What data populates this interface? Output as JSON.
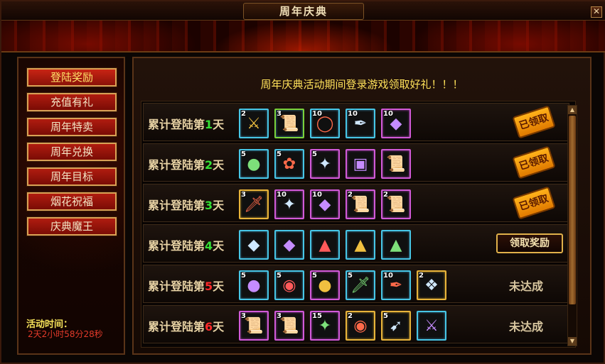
{
  "window": {
    "title": "周年庆典",
    "close_glyph": "✕"
  },
  "sidebar": {
    "items": [
      {
        "label": "登陆奖励",
        "active": true
      },
      {
        "label": "充值有礼"
      },
      {
        "label": "周年特卖"
      },
      {
        "label": "周年兑换"
      },
      {
        "label": "周年目标"
      },
      {
        "label": "烟花祝福"
      },
      {
        "label": "庆典魔王"
      }
    ],
    "activity_time_label": "活动时间：",
    "activity_time_value": "2天2小时58分28秒"
  },
  "main": {
    "headline": "周年庆典活动期间登录游戏领取好礼！！！",
    "rows": [
      {
        "prefix": "累计登陆第",
        "day": "1",
        "suffix": "天",
        "day_color": "#35e035",
        "status_type": "claimed",
        "status": "已领取",
        "items": [
          {
            "count": "2",
            "icon": "sword-icon",
            "glyph": "⚔",
            "q": ""
          },
          {
            "count": "3",
            "icon": "exp-scroll-icon",
            "glyph": "📜",
            "q": "q-green"
          },
          {
            "count": "10",
            "icon": "ring-icon",
            "glyph": "◯",
            "q": ""
          },
          {
            "count": "10",
            "icon": "feather-icon",
            "glyph": "✒",
            "q": ""
          },
          {
            "count": "10",
            "icon": "crystal-icon",
            "glyph": "◆",
            "q": "q-purple"
          }
        ]
      },
      {
        "prefix": "累计登陆第",
        "day": "2",
        "suffix": "天",
        "day_color": "#35e035",
        "status_type": "claimed",
        "status": "已领取",
        "items": [
          {
            "count": "5",
            "icon": "red-orb-icon",
            "glyph": "●",
            "q": ""
          },
          {
            "count": "5",
            "icon": "rose-icon",
            "glyph": "✿",
            "q": ""
          },
          {
            "count": "5",
            "icon": "purple-crystal-icon",
            "glyph": "✦",
            "q": "q-purple"
          },
          {
            "count": "",
            "icon": "spellbook-icon",
            "glyph": "▣",
            "q": "q-purple"
          },
          {
            "count": "",
            "icon": "scroll-icon",
            "glyph": "📜",
            "q": "q-purple"
          }
        ]
      },
      {
        "prefix": "累计登陆第",
        "day": "3",
        "suffix": "天",
        "day_color": "#35e035",
        "status_type": "claimed",
        "status": "已领取",
        "items": [
          {
            "count": "3",
            "icon": "dagger-icon",
            "glyph": "🗡",
            "q": "q-gold"
          },
          {
            "count": "10",
            "icon": "purple-crystal-icon",
            "glyph": "✦",
            "q": "q-purple"
          },
          {
            "count": "10",
            "icon": "crystal-icon",
            "glyph": "◆",
            "q": "q-purple"
          },
          {
            "count": "2",
            "icon": "scroll-icon",
            "glyph": "📜",
            "q": "q-purple"
          },
          {
            "count": "2",
            "icon": "scroll-icon",
            "glyph": "📜",
            "q": "q-purple"
          }
        ]
      },
      {
        "prefix": "累计登陆第",
        "day": "4",
        "suffix": "天",
        "day_color": "#35e035",
        "status_type": "claim",
        "status": "领取奖励",
        "items": [
          {
            "count": "",
            "icon": "red-gem-icon",
            "glyph": "◆",
            "q": ""
          },
          {
            "count": "",
            "icon": "orange-gem-icon",
            "glyph": "◆",
            "q": ""
          },
          {
            "count": "",
            "icon": "blue-gem-icon",
            "glyph": "▲",
            "q": ""
          },
          {
            "count": "",
            "icon": "gold-gem-icon",
            "glyph": "▲",
            "q": ""
          },
          {
            "count": "",
            "icon": "purple-gem-icon",
            "glyph": "▲",
            "q": ""
          }
        ]
      },
      {
        "prefix": "累计登陆第",
        "day": "5",
        "suffix": "天",
        "day_color": "#ff2a2a",
        "status_type": "pending",
        "status": "未达成",
        "items": [
          {
            "count": "5",
            "icon": "blue-orb-icon",
            "glyph": "●",
            "q": ""
          },
          {
            "count": "5",
            "icon": "blue-orb-icon",
            "glyph": "◉",
            "q": ""
          },
          {
            "count": "5",
            "icon": "red-orb-icon",
            "glyph": "●",
            "q": "q-purple"
          },
          {
            "count": "5",
            "icon": "dagger-icon",
            "glyph": "🗡",
            "q": ""
          },
          {
            "count": "10",
            "icon": "feather-icon",
            "glyph": "✒",
            "q": ""
          },
          {
            "count": "2",
            "icon": "blue-crystal-icon",
            "glyph": "❖",
            "q": "q-gold"
          }
        ]
      },
      {
        "prefix": "累计登陆第",
        "day": "6",
        "suffix": "天",
        "day_color": "#ff2a2a",
        "status_type": "pending",
        "status": "未达成",
        "items": [
          {
            "count": "3",
            "icon": "scroll-icon",
            "glyph": "📜",
            "q": "q-purple"
          },
          {
            "count": "3",
            "icon": "scroll-icon",
            "glyph": "📜",
            "q": "q-purple"
          },
          {
            "count": "15",
            "icon": "purple-crystal-icon",
            "glyph": "✦",
            "q": "q-purple"
          },
          {
            "count": "2",
            "icon": "green-orb-icon",
            "glyph": "◉",
            "q": "q-gold"
          },
          {
            "count": "5",
            "icon": "bow-icon",
            "glyph": "➹",
            "q": "q-gold"
          },
          {
            "count": "",
            "icon": "sword-icon",
            "glyph": "⚔",
            "q": ""
          }
        ]
      }
    ]
  },
  "scrollbar": {
    "up_glyph": "▲",
    "down_glyph": "▼"
  },
  "colors": {
    "accent_gold": "#e0b14a",
    "headline": "#ffe15a",
    "day_reached": "#35e035",
    "day_pending": "#ff2a2a"
  }
}
